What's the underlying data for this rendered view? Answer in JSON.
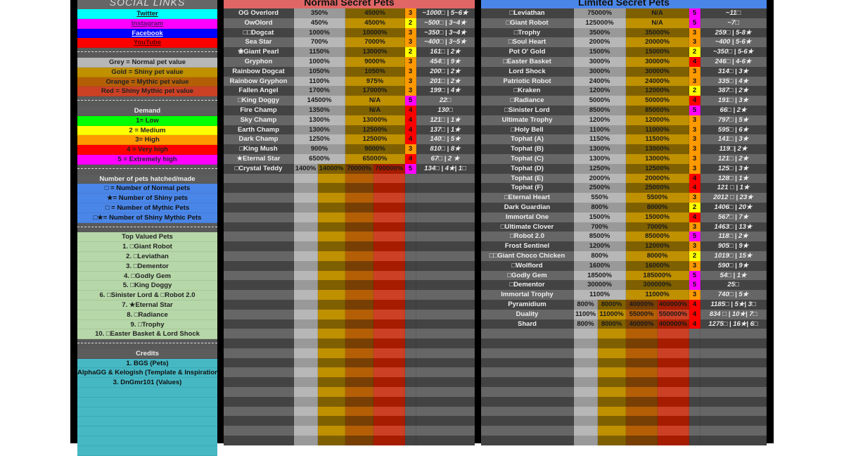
{
  "left_panel": {
    "social_title": "SOCIAL LINKS",
    "links": [
      {
        "label": "Twitter",
        "color": "#00ffff",
        "text_color": "#1a1a1a"
      },
      {
        "label": "Instagram",
        "color": "#ff00ff",
        "text_color": "#5a0a6a"
      },
      {
        "label": "Facebook",
        "color": "#0000ff",
        "text_color": "#e6e6ff"
      },
      {
        "label": "YouTube",
        "color": "#ff0000",
        "text_color": "#5a0000"
      }
    ],
    "value_legend": [
      {
        "label": "Grey = Normal pet value",
        "color": "#b7b7b7"
      },
      {
        "label": "Gold = Shiny pet value",
        "color": "#bf9000"
      },
      {
        "label": "Orange = Mythic pet value",
        "color": "#b45f06"
      },
      {
        "label": "Red = Shiny Mythic pet value",
        "color": "#cc4125"
      }
    ],
    "demand_title": "Demand",
    "demand_legend": [
      {
        "label": "1= Low",
        "color": "#00ff00"
      },
      {
        "label": "2 = Medium",
        "color": "#ffff00"
      },
      {
        "label": "3= High",
        "color": "#ff9900"
      },
      {
        "label": "4 = Very high",
        "color": "#ff0000"
      },
      {
        "label": "5 = Extremely high",
        "color": "#ff00ff"
      }
    ],
    "hatched_title": "Number of pets hatched/made",
    "hatched_legend": [
      {
        "label": "□ = Number of Normal pets"
      },
      {
        "label": "★= Number of Shiny pets"
      },
      {
        "label": "□ = Number of Mythic Pets"
      },
      {
        "label": "□★= Number of  Shiny Mythic Pets"
      }
    ],
    "top_title": "Top Valued Pets",
    "top_list": [
      "1. □Giant Robot",
      "2. □Leviathan",
      "3. □Dementor",
      "4. □Godly Gem",
      "5. □King Doggy",
      "6. □Sinister Lord & □Robot 2.0",
      "7. ★Eternal Star",
      "8. □Radiance",
      "9. □Trophy",
      "10. □Easter Basket & Lord Shock"
    ],
    "credits_title": "Credits",
    "credits": [
      "1. BGS (Pets)",
      "AlphaGG & Kelogish (Template & Inspiration",
      "3. DnGmr101 (Values)"
    ]
  },
  "colors": {
    "normal_light": "#b7b7b7",
    "normal_dark": "#999999",
    "shiny_light": "#bf9000",
    "shiny_dark": "#7f6000",
    "mythic_light": "#b45f06",
    "mythic_dark": "#783f04",
    "smythic_light": "#cc4125",
    "smythic_dark": "#a61c00",
    "row_light": "#666666",
    "row_dark": "#434343",
    "demand": {
      "1": "#00ff00",
      "2": "#ffff00",
      "3": "#ff9900",
      "4": "#ff0000",
      "5": "#ff00ff"
    },
    "normal_header": "#e06666",
    "limited_header": "#4a86e8"
  },
  "normal_table": {
    "title": "Normal Secret Pets",
    "rows": [
      {
        "name": "OG Overlord",
        "normal": "350%",
        "shiny": "4500%",
        "demand": "3",
        "count": "~1000□ | 5~6★"
      },
      {
        "name": "OwOlord",
        "normal": "450%",
        "shiny": "4500%",
        "demand": "2",
        "count": "~500□ | 3~4★"
      },
      {
        "name": "□□Dogcat",
        "normal": "1000%",
        "shiny": "10000%",
        "demand": "3",
        "count": "~350□ | 3~4★"
      },
      {
        "name": "Sea Star",
        "normal": "700%",
        "shiny": "7000%",
        "demand": "3",
        "count": "~400□ | 3~5★"
      },
      {
        "name": "❀Giant Pearl",
        "normal": "1150%",
        "shiny": "13000%",
        "demand": "2",
        "count": "161□ | 2★"
      },
      {
        "name": "Gryphon",
        "normal": "1000%",
        "shiny": "9000%",
        "demand": "3",
        "count": "454□ | 9★"
      },
      {
        "name": "Rainbow Dogcat",
        "normal": "1050%",
        "shiny": "1050%",
        "demand": "3",
        "count": "200□ | 2★"
      },
      {
        "name": "Rainbow Gryphon",
        "normal": "1100%",
        "shiny": "975%",
        "demand": "3",
        "count": "201□ | 2★"
      },
      {
        "name": "Fallen Angel",
        "normal": "1700%",
        "shiny": "17000%",
        "demand": "3",
        "count": "199□ | 4★"
      },
      {
        "name": "□King Doggy",
        "normal": "14500%",
        "shiny": "N/A",
        "demand": "5",
        "count": "22□"
      },
      {
        "name": "Fire Champ",
        "normal": "1350%",
        "shiny": "N/A",
        "demand": "4",
        "count": "130□"
      },
      {
        "name": "Sky Champ",
        "normal": "1300%",
        "shiny": "13000%",
        "demand": "4",
        "count": "121□ | 1★"
      },
      {
        "name": "Earth Champ",
        "normal": "1300%",
        "shiny": "12500%",
        "demand": "4",
        "count": "137□ | 1★"
      },
      {
        "name": "Dark Champ",
        "normal": "1250%",
        "shiny": "12500%",
        "demand": "4",
        "count": "140□ | 5★"
      },
      {
        "name": "□King Mush",
        "normal": "900%",
        "shiny": "9000%",
        "demand": "3",
        "count": "810□ | 8★"
      },
      {
        "name": "★Eternal Star",
        "normal": "6500%",
        "shiny": "65000%",
        "demand": "4",
        "count": "67□ | 2 ★"
      },
      {
        "name": "□Crystal Teddy",
        "normal": "1400%",
        "shiny": "14000%",
        "mythic": "70000%",
        "smythic": "700000%",
        "demand": "5",
        "count": "134□ | 4★| 1□"
      }
    ]
  },
  "limited_table": {
    "title": "Limited Secret Pets",
    "rows": [
      {
        "name": "□Leviathan",
        "normal": "75000%",
        "shiny": "N/A",
        "demand": "5",
        "count": "~11□"
      },
      {
        "name": "□Giant Robot",
        "normal": "125000%",
        "shiny": "N/A",
        "demand": "5",
        "count": "~7□"
      },
      {
        "name": "□Trophy",
        "normal": "3500%",
        "shiny": "35000%",
        "demand": "3",
        "count": "259□ | 5-8★"
      },
      {
        "name": "□Soul Heart",
        "normal": "2000%",
        "shiny": "20000%",
        "demand": "3",
        "count": "~400 | 5-6★"
      },
      {
        "name": "Pot O' Gold",
        "normal": "1500%",
        "shiny": "15000%",
        "demand": "2",
        "count": "~350□ | 5-6★"
      },
      {
        "name": "□Easter Basket",
        "normal": "3000%",
        "shiny": "30000%",
        "demand": "4",
        "count": "246□ | 4-6★"
      },
      {
        "name": "Lord Shock",
        "normal": "3000%",
        "shiny": "30000%",
        "demand": "3",
        "count": "314□ | 3★"
      },
      {
        "name": "Patriotic Robot",
        "normal": "2400%",
        "shiny": "24000%",
        "demand": "3",
        "count": "335□ | 4★"
      },
      {
        "name": "□Kraken",
        "normal": "1200%",
        "shiny": "12000%",
        "demand": "2",
        "count": "387□ | 2★"
      },
      {
        "name": "□Radiance",
        "normal": "5000%",
        "shiny": "50000%",
        "demand": "4",
        "count": "191□ | 3★"
      },
      {
        "name": "□Sinister Lord",
        "normal": "8500%",
        "shiny": "85000%",
        "demand": "5",
        "count": "66□ | 2★"
      },
      {
        "name": "Ultimate Trophy",
        "normal": "1200%",
        "shiny": "12000%",
        "demand": "3",
        "count": "797□ | 5★"
      },
      {
        "name": "□Holy Bell",
        "normal": "1100%",
        "shiny": "11000%",
        "demand": "3",
        "count": "595□ | 6★"
      },
      {
        "name": "Tophat (A)",
        "normal": "1150%",
        "shiny": "11500%",
        "demand": "3",
        "count": "141□ | 3★"
      },
      {
        "name": "Tophat (B)",
        "normal": "1300%",
        "shiny": "13000%",
        "demand": "3",
        "count": "119□| 2★"
      },
      {
        "name": "Tophat (C)",
        "normal": "1300%",
        "shiny": "13000%",
        "demand": "3",
        "count": "121□ | 2★"
      },
      {
        "name": "Tophat (D)",
        "normal": "1250%",
        "shiny": "12500%",
        "demand": "3",
        "count": "125□ | 3★"
      },
      {
        "name": "Tophat (E)",
        "normal": "2000%",
        "shiny": "20000%",
        "demand": "4",
        "count": "128□ | 1★"
      },
      {
        "name": "Tophat (F)",
        "normal": "2500%",
        "shiny": "25000%",
        "demand": "4",
        "count": "121 □ | 1★"
      },
      {
        "name": "□Eternal Heart",
        "normal": "550%",
        "shiny": "5500%",
        "demand": "3",
        "count": "2012 □ | 23★"
      },
      {
        "name": "Dark Guardian",
        "normal": "800%",
        "shiny": "8000%",
        "demand": "2",
        "count": "1406□ | 20★"
      },
      {
        "name": "Immortal One",
        "normal": "1500%",
        "shiny": "15000%",
        "demand": "4",
        "count": "567□ | 7★"
      },
      {
        "name": "□Ultimate Clover",
        "normal": "700%",
        "shiny": "7000%",
        "demand": "3",
        "count": "1463□ | 13★"
      },
      {
        "name": "□Robot 2.0",
        "normal": "8500%",
        "shiny": "85000%",
        "demand": "5",
        "count": "118□ | 2★"
      },
      {
        "name": "Frost Sentinel",
        "normal": "1200%",
        "shiny": "12000%",
        "demand": "3",
        "count": "905□ | 9★"
      },
      {
        "name": "□□Giant Choco Chicken",
        "normal": "800%",
        "shiny": "8000%",
        "demand": "2",
        "count": "1019□ | 15★"
      },
      {
        "name": "□Wolflord",
        "normal": "1600%",
        "shiny": "16000%",
        "demand": "3",
        "count": "590□ | 9★"
      },
      {
        "name": "□Godly Gem",
        "normal": "18500%",
        "shiny": "185000%",
        "demand": "5",
        "count": "54□ | 1★"
      },
      {
        "name": "□Dementor",
        "normal": "30000%",
        "shiny": "300000%",
        "demand": "5",
        "count": "25□"
      },
      {
        "name": "Immortal Trophy",
        "normal": "1100%",
        "shiny": "11000%",
        "demand": "3",
        "count": "740□ | 5★"
      },
      {
        "name": "Pyramidium",
        "normal": "800%",
        "shiny": "8000%",
        "mythic": "40000%",
        "smythic": "400000%",
        "demand": "4",
        "count": "1185□ | 5★| 3□"
      },
      {
        "name": "Duality",
        "normal": "1100%",
        "shiny": "11000%",
        "mythic": "55000%",
        "smythic": "550000%",
        "demand": "4",
        "count": "834 □ | 10★| 7□"
      },
      {
        "name": "Shard",
        "normal": "800%",
        "shiny": "8000%",
        "mythic": "40000%",
        "smythic": "400000%",
        "demand": "4",
        "count": "1275□ | 16★| 6□"
      }
    ]
  }
}
